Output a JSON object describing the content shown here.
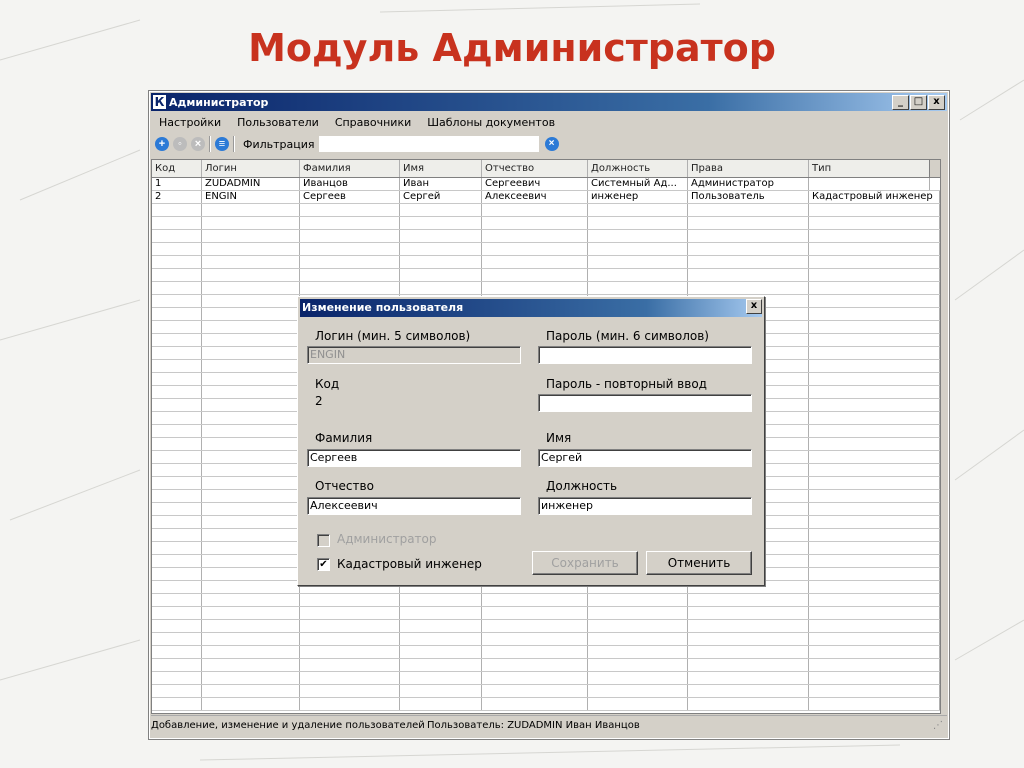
{
  "slide_title": "Модуль Администратор",
  "window": {
    "title": "Администратор",
    "app_icon": "К",
    "minimize": "_",
    "maximize": "□",
    "close": "x"
  },
  "menu": [
    "Настройки",
    "Пользователи",
    "Справочники",
    "Шаблоны документов"
  ],
  "toolbar": {
    "filter_label": "Фильтрация",
    "filter_value": ""
  },
  "grid": {
    "columns": [
      "Код",
      "Логин",
      "Фамилия",
      "Имя",
      "Отчество",
      "Должность",
      "Права",
      "Тип"
    ],
    "rows": [
      [
        "1",
        "ZUDADMIN",
        "Иванцов",
        "Иван",
        "Сергеевич",
        "Системный Ад...",
        "Администратор",
        ""
      ],
      [
        "2",
        "ENGIN",
        "Сергеев",
        "Сергей",
        "Алексеевич",
        "инженер",
        "Пользователь",
        "Кадастровый инженер"
      ]
    ]
  },
  "status": {
    "left": "Добавление, изменение и удаление пользователей",
    "user": "Пользователь: ZUDADMIN  Иван Иванцов"
  },
  "dialog": {
    "title": "Изменение пользователя",
    "close": "x",
    "login_label": "Логин (мин. 5 символов)",
    "login_value": "ENGIN",
    "password_label": "Пароль (мин. 6 символов)",
    "password_value": "",
    "code_label": "Код",
    "code_value": "2",
    "password_repeat_label": "Пароль - повторный ввод",
    "password_repeat_value": "",
    "lastname_label": "Фамилия",
    "lastname_value": "Сергеев",
    "firstname_label": "Имя",
    "firstname_value": "Сергей",
    "patronymic_label": "Отчество",
    "patronymic_value": "Алексеевич",
    "position_label": "Должность",
    "position_value": "инженер",
    "admin_label": "Администратор",
    "cadastral_label": "Кадастровый инженер",
    "cadastral_checked": "✔",
    "save_label": "Сохранить",
    "cancel_label": "Отменить"
  },
  "colors": {
    "title_red": "#c8321e",
    "titlebar": "#0a246a",
    "add_icon": "#2c7ad6"
  }
}
